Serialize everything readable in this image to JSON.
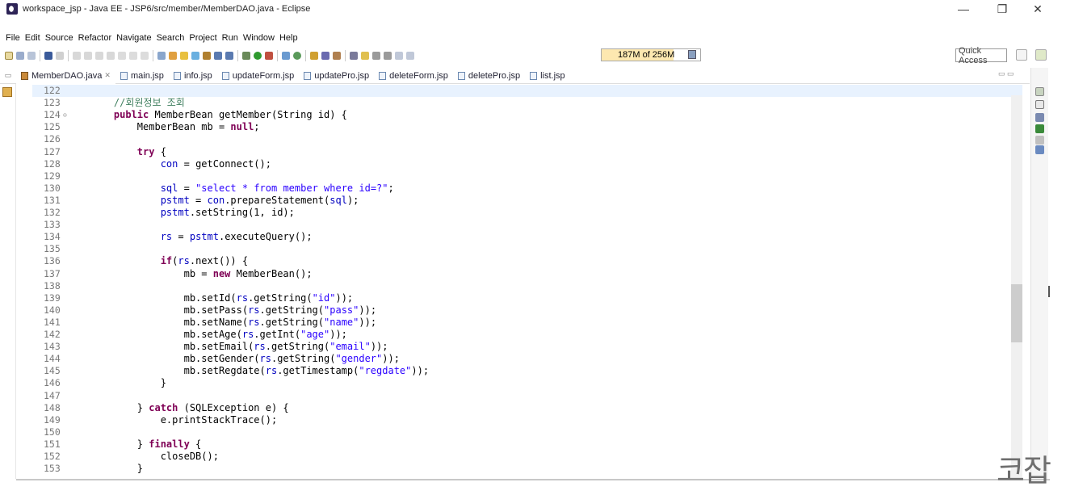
{
  "window": {
    "title": "workspace_jsp - Java EE - JSP6/src/member/MemberDAO.java - Eclipse",
    "controls": {
      "minimize": "—",
      "maximize": "❐",
      "close": "✕"
    }
  },
  "menu": [
    "File",
    "Edit",
    "Source",
    "Refactor",
    "Navigate",
    "Search",
    "Project",
    "Run",
    "Window",
    "Help"
  ],
  "toolbar": {
    "heap_status": "187M of 256M",
    "heap_fraction": 0.73,
    "quick_access_placeholder": "Quick Access"
  },
  "tabs": [
    {
      "label": "MemberDAO.java",
      "active": true,
      "close": "✕"
    },
    {
      "label": "main.jsp"
    },
    {
      "label": "info.jsp"
    },
    {
      "label": "updateForm.jsp"
    },
    {
      "label": "updatePro.jsp"
    },
    {
      "label": "deleteForm.jsp"
    },
    {
      "label": "deletePro.jsp"
    },
    {
      "label": "list.jsp"
    }
  ],
  "editor": {
    "current_line": 122,
    "lines": [
      {
        "n": "122",
        "code": ""
      },
      {
        "n": "123",
        "code": "    //회원정보 조회"
      },
      {
        "n": "124",
        "code": "    public MemberBean getMember(String id) {",
        "fold": true
      },
      {
        "n": "125",
        "code": "        MemberBean mb = null;"
      },
      {
        "n": "126",
        "code": ""
      },
      {
        "n": "127",
        "code": "        try {"
      },
      {
        "n": "128",
        "code": "            con = getConnect();"
      },
      {
        "n": "129",
        "code": ""
      },
      {
        "n": "130",
        "code": "            sql = \"select * from member where id=?\";"
      },
      {
        "n": "131",
        "code": "            pstmt = con.prepareStatement(sql);"
      },
      {
        "n": "132",
        "code": "            pstmt.setString(1, id);"
      },
      {
        "n": "133",
        "code": ""
      },
      {
        "n": "134",
        "code": "            rs = pstmt.executeQuery();"
      },
      {
        "n": "135",
        "code": ""
      },
      {
        "n": "136",
        "code": "            if(rs.next()) {"
      },
      {
        "n": "137",
        "code": "                mb = new MemberBean();"
      },
      {
        "n": "138",
        "code": ""
      },
      {
        "n": "139",
        "code": "                mb.setId(rs.getString(\"id\"));"
      },
      {
        "n": "140",
        "code": "                mb.setPass(rs.getString(\"pass\"));"
      },
      {
        "n": "141",
        "code": "                mb.setName(rs.getString(\"name\"));"
      },
      {
        "n": "142",
        "code": "                mb.setAge(rs.getInt(\"age\"));"
      },
      {
        "n": "143",
        "code": "                mb.setEmail(rs.getString(\"email\"));"
      },
      {
        "n": "144",
        "code": "                mb.setGender(rs.getString(\"gender\"));"
      },
      {
        "n": "145",
        "code": "                mb.setRegdate(rs.getTimestamp(\"regdate\"));"
      },
      {
        "n": "146",
        "code": "            }"
      },
      {
        "n": "147",
        "code": ""
      },
      {
        "n": "148",
        "code": "        } catch (SQLException e) {"
      },
      {
        "n": "149",
        "code": "            e.printStackTrace();"
      },
      {
        "n": "150",
        "code": ""
      },
      {
        "n": "151",
        "code": "        } finally {"
      },
      {
        "n": "152",
        "code": "            closeDB();"
      },
      {
        "n": "153",
        "code": "        }"
      }
    ]
  },
  "watermark": "코잡",
  "colors": {
    "keyword": "#7f0055",
    "string": "#2a00ff",
    "comment": "#3f7f5f",
    "field": "#0000c0",
    "current_line_bg": "#e8f2fe"
  }
}
